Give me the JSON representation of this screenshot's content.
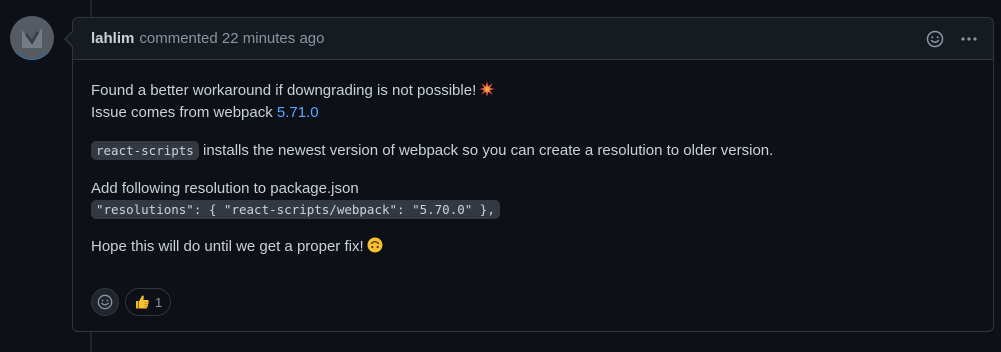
{
  "comment": {
    "author": "lahlim",
    "meta": "commented 22 minutes ago",
    "body": {
      "line1": "Found a better workaround if downgrading is not possible!",
      "line1_emoji": "collision-emoji",
      "line2_prefix": "Issue comes from webpack ",
      "line2_link": "5.71.0",
      "para2_code": "react-scripts",
      "para2_text": " installs the newest version of webpack so you can create a resolution to older version.",
      "para3_line1": "Add following resolution to package.json",
      "para3_code": "\"resolutions\": { \"react-scripts/webpack\": \"5.70.0\" },",
      "para4_text": "Hope this will do until we get a proper fix!",
      "para4_emoji": "upside-down-face-emoji"
    },
    "header_actions": [
      "smiley-icon",
      "kebab-icon"
    ],
    "reactions": [
      {
        "emoji": "thumbs-up-emoji",
        "count": "1"
      }
    ]
  },
  "colors": {
    "background": "#0d1117",
    "header": "#161b22",
    "border": "#30363d",
    "link": "#58a6ff",
    "muted": "#8b949e",
    "text": "#c9d1d9"
  }
}
